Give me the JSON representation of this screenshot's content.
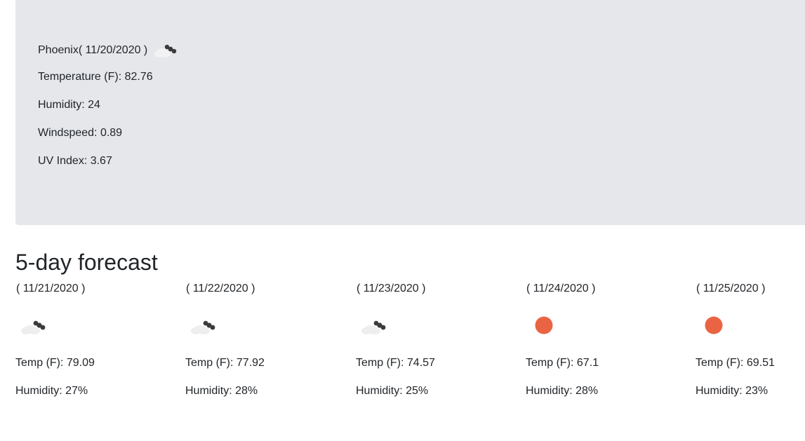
{
  "current": {
    "city_line": "Phoenix( 11/20/2020 )",
    "icon": "partly-cloudy-night-icon",
    "temperature": "Temperature (F): 82.76",
    "humidity": "Humidity: 24",
    "windspeed": "Windspeed: 0.89",
    "uv_index": "UV Index: 3.67"
  },
  "forecast": {
    "heading": "5-day forecast",
    "days": [
      {
        "date": "( 11/21/2020 )",
        "icon": "partly-cloudy-night-icon",
        "temp": "Temp (F): 79.09",
        "humidity": "Humidity: 27%"
      },
      {
        "date": "( 11/22/2020 )",
        "icon": "partly-cloudy-night-icon",
        "temp": "Temp (F): 77.92",
        "humidity": "Humidity: 28%"
      },
      {
        "date": "( 11/23/2020 )",
        "icon": "partly-cloudy-night-icon",
        "temp": "Temp (F): 74.57",
        "humidity": "Humidity: 25%"
      },
      {
        "date": "( 11/24/2020 )",
        "icon": "sun-icon",
        "temp": "Temp (F): 67.1",
        "humidity": "Humidity: 28%"
      },
      {
        "date": "( 11/25/2020 )",
        "icon": "sun-icon",
        "temp": "Temp (F): 69.51",
        "humidity": "Humidity: 23%"
      }
    ]
  },
  "colors": {
    "panel_bg": "#e5e7eb",
    "sun": "#ea6443",
    "cloud": "#eeeeee",
    "cloud_dark": "#3a3a3a"
  }
}
